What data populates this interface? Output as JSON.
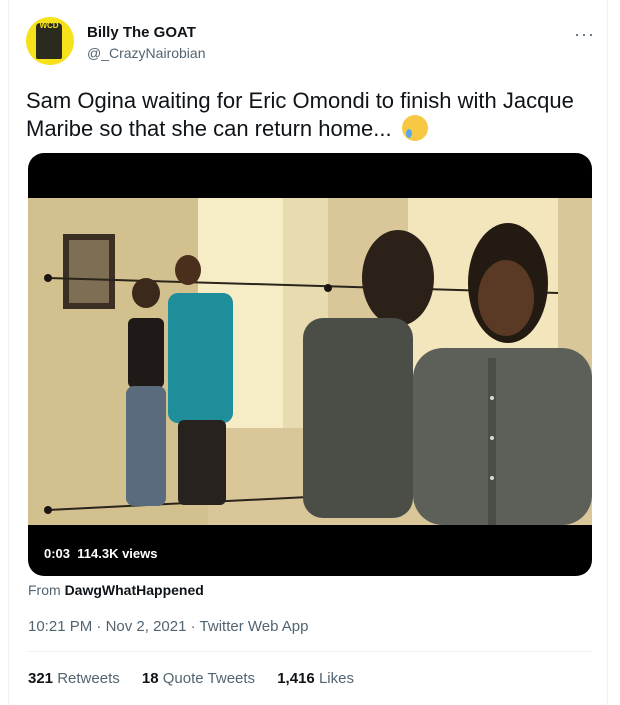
{
  "author": {
    "display_name": "Billy The GOAT",
    "handle": "@_CrazyNairobian",
    "avatar_text": "WCD"
  },
  "more_label": "···",
  "tweet": {
    "text": "Sam Ogina waiting for Eric Omondi to finish with Jacque Maribe so that she can return home...",
    "emoji": "crying-face-emoji"
  },
  "video": {
    "time": "0:03",
    "views": "114.3K views"
  },
  "source": {
    "prefix": "From",
    "account": "DawgWhatHappened"
  },
  "meta": {
    "time": "10:21 PM",
    "sep1": "·",
    "date": "Nov 2, 2021",
    "sep2": "·",
    "client": "Twitter Web App"
  },
  "engagement": {
    "retweets_count": "321",
    "retweets_label": "Retweets",
    "quotes_count": "18",
    "quotes_label": "Quote Tweets",
    "likes_count": "1,416",
    "likes_label": "Likes"
  },
  "colors": {
    "text": "#0f1419",
    "secondary": "#536471",
    "border": "#eff3f4"
  }
}
